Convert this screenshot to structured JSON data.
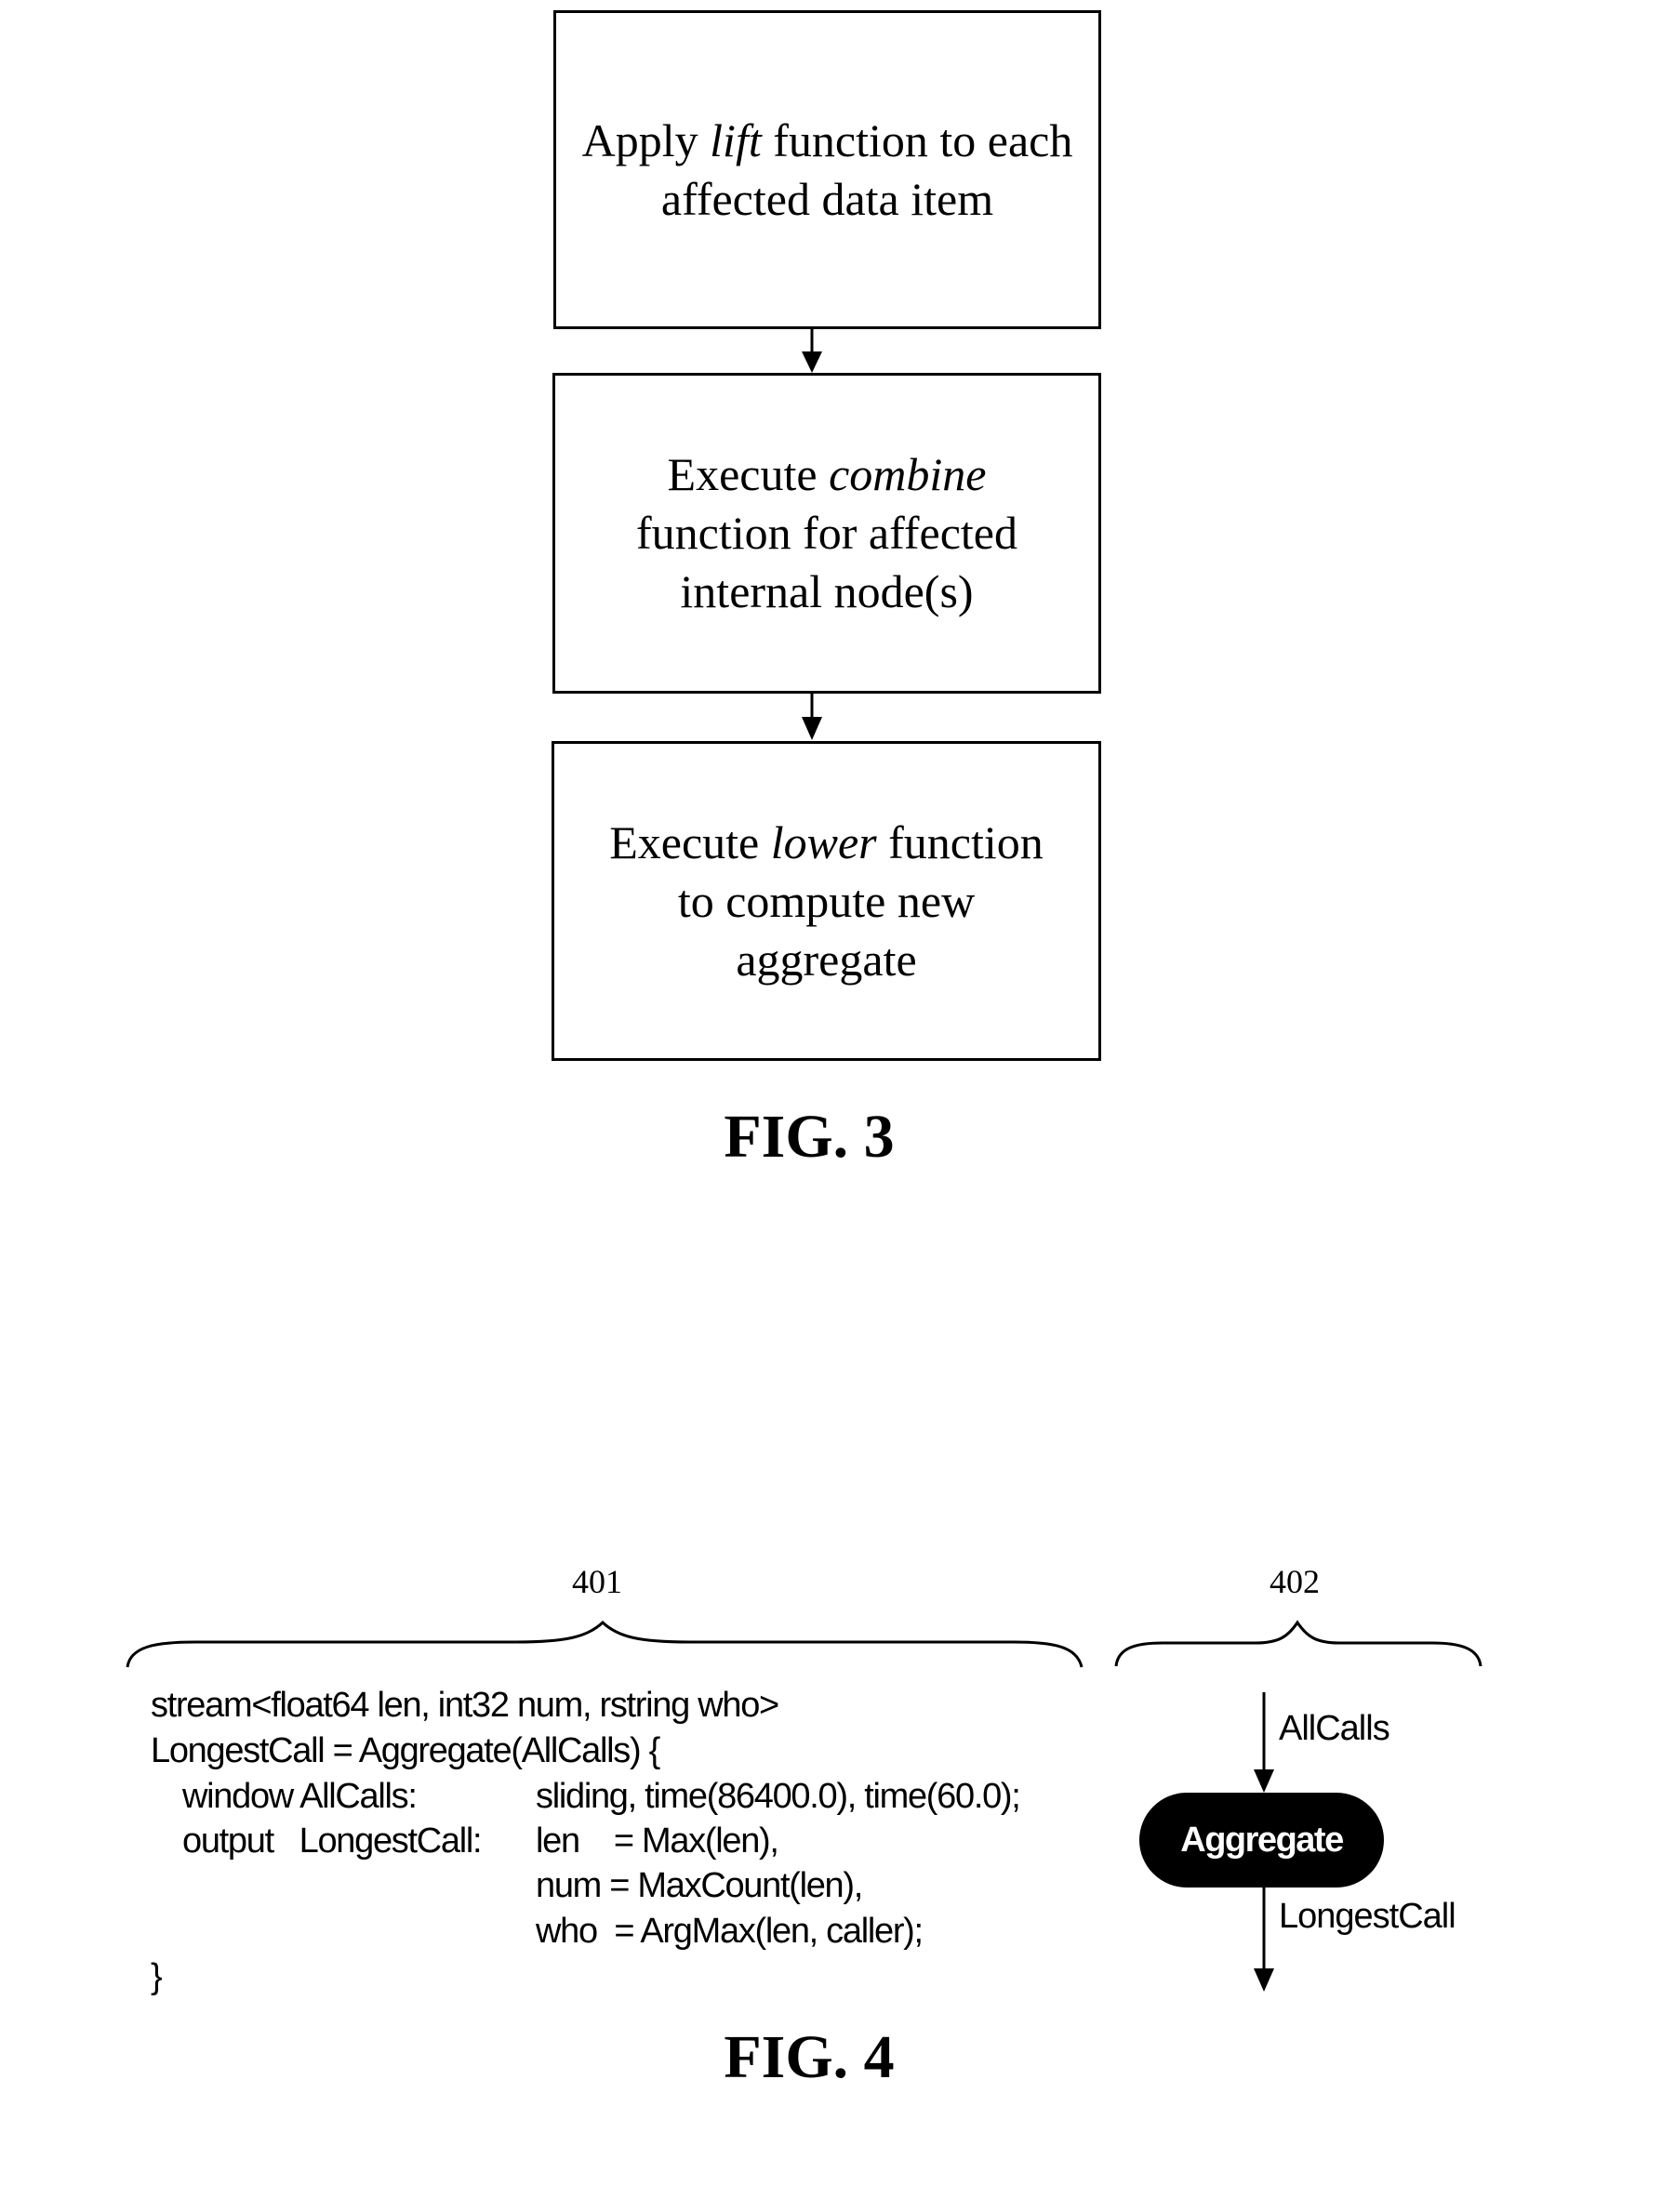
{
  "fig3": {
    "caption": "FIG. 3",
    "steps": [
      {
        "before": "Apply ",
        "emph": "lift",
        "after": " function to each affected data item"
      },
      {
        "before": "Execute ",
        "emph": "combine",
        "after": " function for affected internal node(s)"
      },
      {
        "before": "Execute ",
        "emph": "lower",
        "after": " function to compute new aggregate"
      }
    ]
  },
  "fig4": {
    "caption": "FIG. 4",
    "ref_code": "401",
    "ref_graph": "402",
    "code": {
      "line1": "stream<float64 len, int32 num, rstring who>",
      "line2": "LongestCall = Aggregate(AllCalls) {",
      "line3_key": "window AllCalls:",
      "line3_val": "sliding, time(86400.0), time(60.0);",
      "line4_key": "output   LongestCall:",
      "line4_val": "len    = Max(len),",
      "line5_val": "num = MaxCount(len),",
      "line6_val": "who  = ArgMax(len, caller);",
      "line7": "}"
    },
    "graph": {
      "input_stream": "AllCalls",
      "operator": "Aggregate",
      "output_stream": "LongestCall"
    }
  }
}
